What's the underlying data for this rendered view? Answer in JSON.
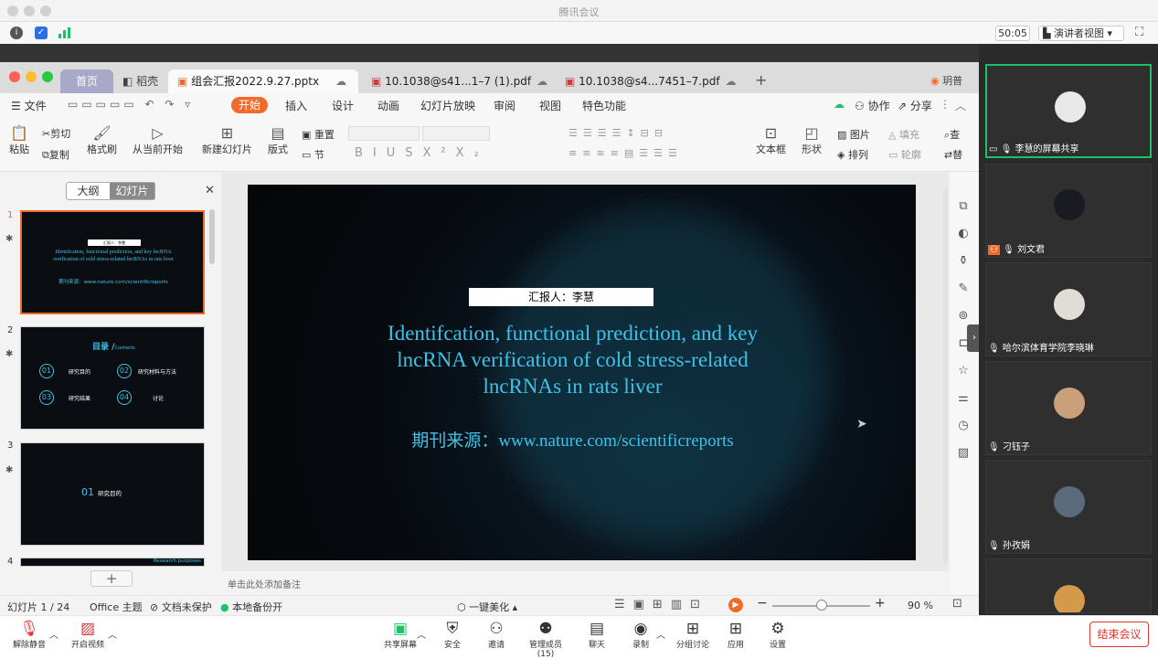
{
  "window": {
    "title": "腾讯会议"
  },
  "infobar": {
    "timer": "50:05",
    "view_mode": "演讲者视图"
  },
  "tabs": [
    {
      "label": "首页"
    },
    {
      "label": "稻壳"
    },
    {
      "label": "组会汇报2022.9.27.pptx"
    },
    {
      "label": "10.1038@s41...1–7 (1).pdf"
    },
    {
      "label": "10.1038@s4...7451–7.pdf"
    }
  ],
  "user": {
    "name": "玥普"
  },
  "menu": {
    "file": "文件",
    "items": [
      "开始",
      "插入",
      "设计",
      "动画",
      "幻灯片放映",
      "审阅",
      "视图",
      "特色功能"
    ],
    "collab": "协作",
    "share": "分享"
  },
  "ribbon": {
    "paste": "粘贴",
    "cut": "剪切",
    "copy": "复制",
    "format_painter": "格式刷",
    "from_current": "从当前开始",
    "new_slide": "新建幻灯片",
    "layout": "版式",
    "reset": "重置",
    "section": "节",
    "textbox": "文本框",
    "shape": "形状",
    "picture": "图片",
    "arrange": "排列",
    "fill": "填充",
    "outline": "轮廓",
    "find": "查",
    "replace": "替"
  },
  "left_panel": {
    "tab_outline": "大纲",
    "tab_slides": "幻灯片",
    "add": "+"
  },
  "slides": [
    {
      "num": "1",
      "reporter": "汇报人：李慧",
      "title": "Identifcation, functional prediction, and key lncRNA verification of cold stress-related lncRNAs in rats liver",
      "source": "期刊来源：www.nature.com/scientificreports"
    },
    {
      "num": "2",
      "toc": "目录 /",
      "toc_sub": "Contents",
      "items": [
        {
          "n": "01",
          "t": "研究目的"
        },
        {
          "n": "02",
          "t": "研究材料与方法"
        },
        {
          "n": "03",
          "t": "研究结果"
        },
        {
          "n": "04",
          "t": "讨论"
        }
      ]
    },
    {
      "num": "3",
      "n": "01",
      "t": "研究目的"
    },
    {
      "num": "4",
      "t": "Research purposes"
    }
  ],
  "main_slide": {
    "reporter": "汇报人：李慧",
    "title_lines": [
      "Identifcation, functional prediction, and key",
      "lncRNA verification of cold stress-related",
      "lncRNAs in rats liver"
    ],
    "source": "期刊来源：www.nature.com/scientificreports"
  },
  "notes": {
    "placeholder": "单击此处添加备注"
  },
  "status": {
    "slide_count": "幻灯片 1 / 24",
    "theme": "Office 主题",
    "protect": "文档未保护",
    "backup": "本地备份开",
    "beautify": "一键美化",
    "zoom": "90 %",
    "zoom_level": 0.5
  },
  "participants": [
    {
      "name": "李慧的屏幕共享",
      "avatar_color": "#e8e8e8",
      "active": true
    },
    {
      "name": "刘文君",
      "avatar_color": "#1a1a22"
    },
    {
      "name": "哈尔滨体育学院李晓琳",
      "avatar_color": "#e0ddd6"
    },
    {
      "name": "刁钰子",
      "avatar_color": "#c9a07a"
    },
    {
      "name": "孙孜娟",
      "avatar_color": "#5a6a7a"
    },
    {
      "name": "",
      "avatar_color": "#d29a4a"
    }
  ],
  "bottom": {
    "unmute": "解除静音",
    "start_video": "开启视频",
    "share_screen": "共享屏幕",
    "security": "安全",
    "invite": "邀请",
    "manage": "管理成员(15)",
    "chat": "聊天",
    "record": "录制",
    "breakout": "分组讨论",
    "apps": "应用",
    "settings": "设置",
    "end": "结束会议"
  },
  "colors": {
    "accent": "#f06b2a",
    "slide_title": "#3ec3e8",
    "meeting_green": "#1fc06a",
    "end_red": "#e0392e"
  }
}
